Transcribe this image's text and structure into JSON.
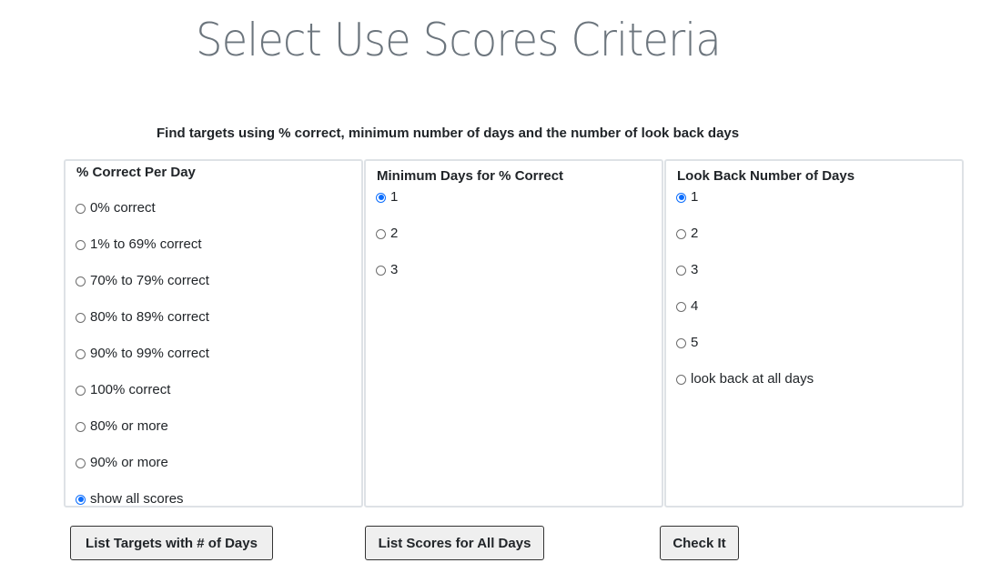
{
  "page": {
    "title": "Select Use Scores Criteria",
    "subtitle": "Find targets using % correct, minimum number of days and the number of look back days"
  },
  "panels": {
    "percent_correct": {
      "heading": "% Correct Per Day",
      "options": [
        {
          "label": "0% correct",
          "checked": false
        },
        {
          "label": "1% to 69% correct",
          "checked": false
        },
        {
          "label": "70% to 79% correct",
          "checked": false
        },
        {
          "label": "80% to 89% correct",
          "checked": false
        },
        {
          "label": "90% to 99% correct",
          "checked": false
        },
        {
          "label": "100% correct",
          "checked": false
        },
        {
          "label": "80% or more",
          "checked": false
        },
        {
          "label": "90% or more",
          "checked": false
        },
        {
          "label": "show all scores",
          "checked": true
        }
      ]
    },
    "minimum_days": {
      "heading": "Minimum Days for % Correct",
      "options": [
        {
          "label": "1",
          "checked": true
        },
        {
          "label": "2",
          "checked": false
        },
        {
          "label": "3",
          "checked": false
        }
      ]
    },
    "look_back_days": {
      "heading": "Look Back Number of Days",
      "options": [
        {
          "label": "1",
          "checked": true
        },
        {
          "label": "2",
          "checked": false
        },
        {
          "label": "3",
          "checked": false
        },
        {
          "label": "4",
          "checked": false
        },
        {
          "label": "5",
          "checked": false
        },
        {
          "label": "look back at all days",
          "checked": false
        }
      ]
    }
  },
  "buttons": {
    "list_targets": "List Targets with # of Days",
    "list_scores": "List Scores for All Days",
    "check_it": "Check It"
  },
  "colors": {
    "accent": "#0d6efd",
    "title": "#6c757d",
    "panel_border": "#dee2e6",
    "button_bg": "#efefef"
  }
}
